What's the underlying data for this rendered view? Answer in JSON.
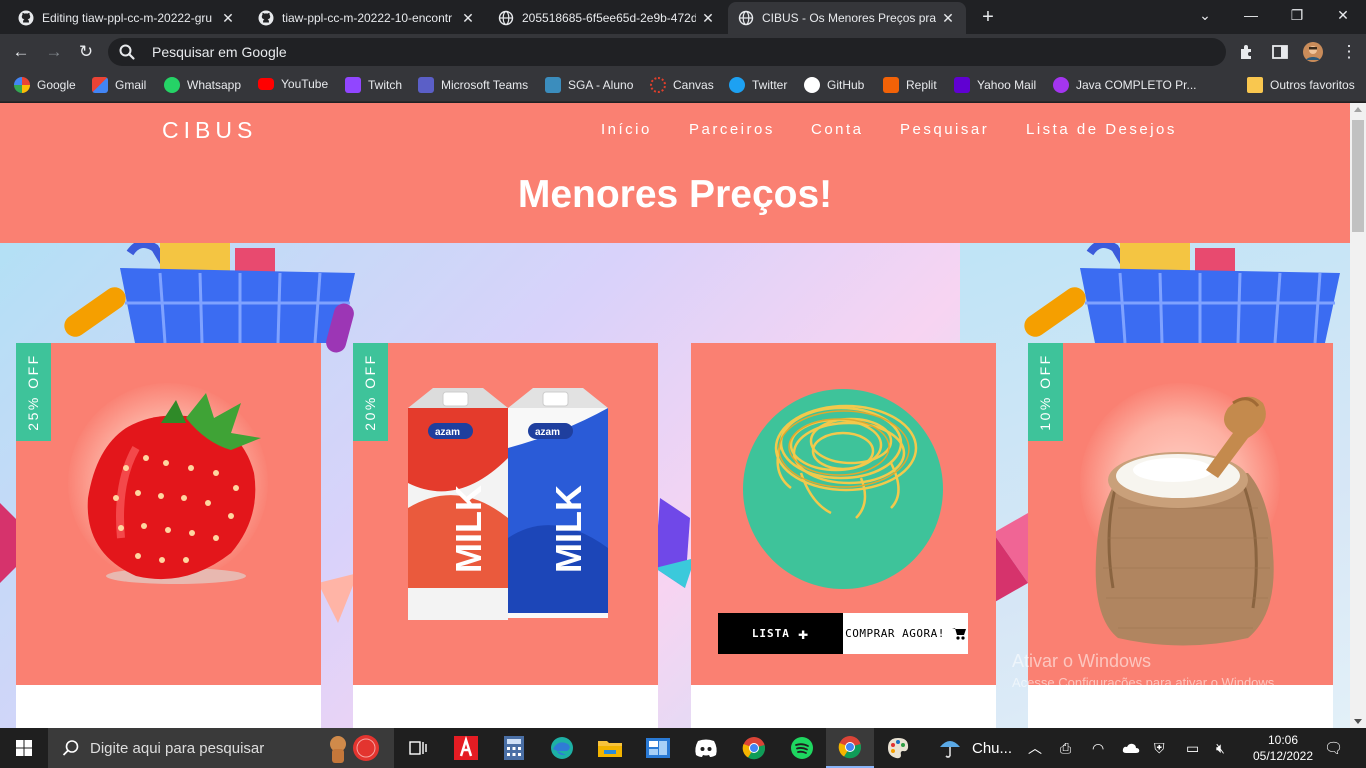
{
  "browser": {
    "tabs": [
      {
        "title": "Editing tiaw-ppl-cc-m-20222-gru",
        "icon": "github-icon"
      },
      {
        "title": "tiaw-ppl-cc-m-20222-10-encontr",
        "icon": "github-icon"
      },
      {
        "title": "205518685-6f5ee65d-2e9b-472d",
        "icon": "globe-icon"
      },
      {
        "title": "CIBUS - Os Menores Preços pra V",
        "icon": "globe-icon",
        "active": true
      }
    ],
    "omnibox_text": "Pesquisar em Google",
    "bookmarks": [
      {
        "label": "Google",
        "color": "#4285f4"
      },
      {
        "label": "Gmail",
        "color": "#ea4335"
      },
      {
        "label": "Whatsapp",
        "color": "#25d366"
      },
      {
        "label": "YouTube",
        "color": "#ff0000"
      },
      {
        "label": "Twitch",
        "color": "#9146ff"
      },
      {
        "label": "Microsoft Teams",
        "color": "#5b5fc7"
      },
      {
        "label": "SGA - Aluno",
        "color": "#3b8dbd"
      },
      {
        "label": "Canvas",
        "color": "#e13f2b"
      },
      {
        "label": "Twitter",
        "color": "#1da1f2"
      },
      {
        "label": "GitHub",
        "color": "#ffffff"
      },
      {
        "label": "Replit",
        "color": "#f26207"
      },
      {
        "label": "Yahoo Mail",
        "color": "#6001d2"
      },
      {
        "label": "Java COMPLETO Pr...",
        "color": "#a435f0"
      },
      {
        "label": "Outros favoritos",
        "color": "#f9c74f"
      }
    ]
  },
  "site": {
    "logo": "CIBUS",
    "nav": [
      "Início",
      "Parceiros",
      "Conta",
      "Pesquisar",
      "Lista de Desejos"
    ],
    "headline": "Menores Preços!",
    "colors": {
      "primary": "#fa8072",
      "accent": "#3ec39a"
    },
    "products": [
      {
        "image": "strawberry",
        "discount": "25% OFF"
      },
      {
        "image": "milk-cartons",
        "discount": "20% OFF"
      },
      {
        "image": "noodles",
        "discount": "",
        "buttons": {
          "list": "LISTA",
          "buy": "COMPRAR AGORA!"
        }
      },
      {
        "image": "rice-sack",
        "discount": "10% OFF"
      }
    ]
  },
  "windows": {
    "activation_title": "Ativar o Windows",
    "activation_sub": "Acesse Configurações para ativar o Windows.",
    "search_placeholder": "Digite aqui para pesquisar",
    "tray_weather": "Chu...",
    "time": "10:06",
    "date": "05/12/2022"
  }
}
